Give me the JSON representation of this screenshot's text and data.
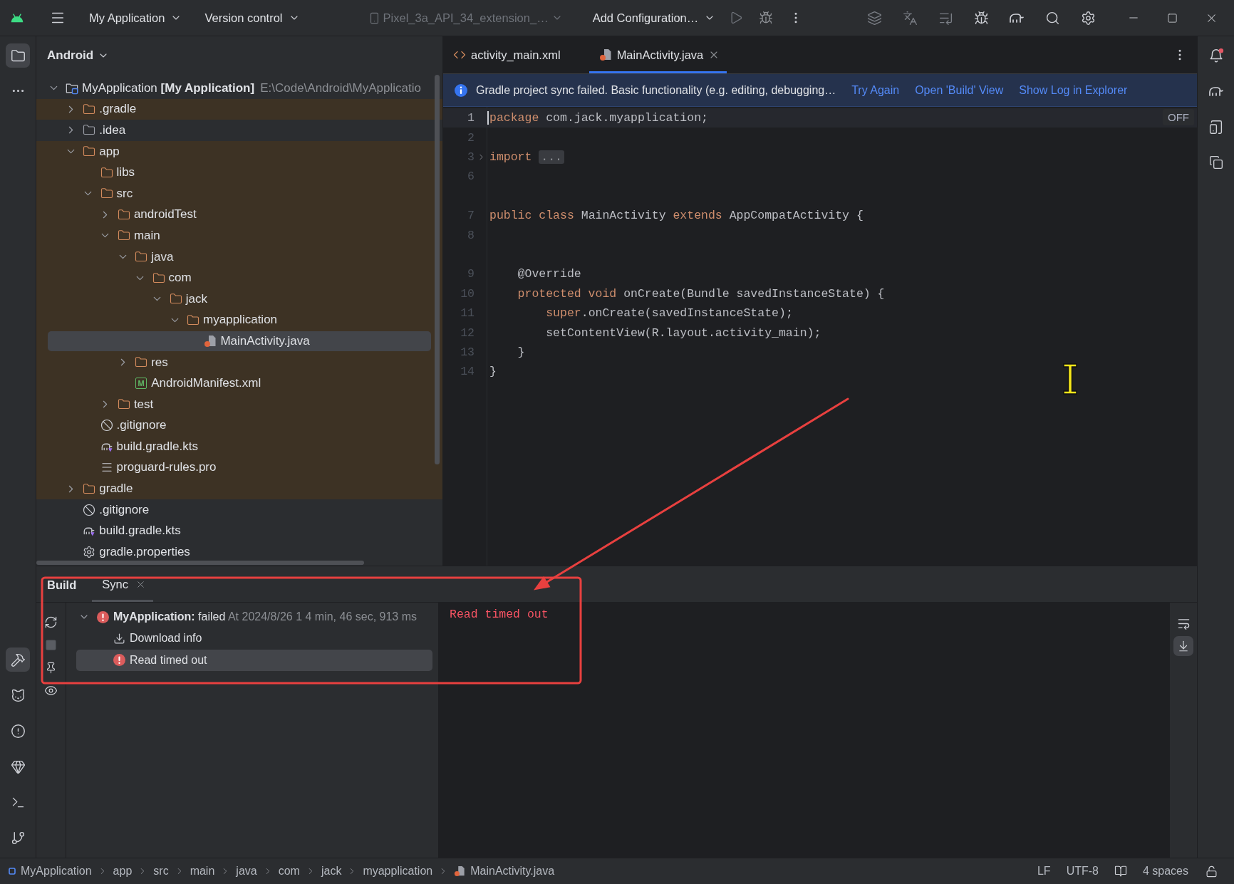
{
  "title_bar": {
    "project": "My Application",
    "vcs": "Version control",
    "device": {
      "label": "Pixel_3a_API_34_extension_…",
      "disabled": true
    },
    "configuration": "Add Configuration…"
  },
  "project_panel": {
    "view": "Android",
    "tree": [
      {
        "label": "MyApplication **[My Application]**",
        "path": "E:\\Code\\Android\\MyApplicatio",
        "kind": "module",
        "expanded": true,
        "tinted": false,
        "selected": false,
        "children": [
          {
            "label": ".gradle",
            "kind": "folder",
            "expanded": false,
            "tinted": true,
            "selected": false
          },
          {
            "label": ".idea",
            "kind": "folder",
            "expanded": false,
            "tinted": false,
            "selected": false
          },
          {
            "label": "app",
            "kind": "folder",
            "expanded": true,
            "tinted": true,
            "selected": false,
            "children": [
              {
                "label": "libs",
                "kind": "folder",
                "tinted": true,
                "selected": false
              },
              {
                "label": "src",
                "kind": "folder",
                "expanded": true,
                "tinted": true,
                "selected": false,
                "children": [
                  {
                    "label": "androidTest",
                    "kind": "folder",
                    "expanded": false,
                    "tinted": true,
                    "selected": false
                  },
                  {
                    "label": "main",
                    "kind": "folder",
                    "expanded": true,
                    "tinted": true,
                    "selected": false,
                    "children": [
                      {
                        "label": "java",
                        "kind": "folder",
                        "expanded": true,
                        "tinted": true,
                        "selected": false,
                        "children": [
                          {
                            "label": "com",
                            "kind": "folder",
                            "expanded": true,
                            "tinted": true,
                            "selected": false,
                            "children": [
                              {
                                "label": "jack",
                                "kind": "folder",
                                "expanded": true,
                                "tinted": true,
                                "selected": false,
                                "children": [
                                  {
                                    "label": "myapplication",
                                    "kind": "folder",
                                    "expanded": true,
                                    "tinted": true,
                                    "selected": false,
                                    "children": [
                                      {
                                        "label": "MainActivity.java",
                                        "kind": "java",
                                        "tinted": true,
                                        "selected": true
                                      }
                                    ]
                                  }
                                ]
                              }
                            ]
                          }
                        ]
                      },
                      {
                        "label": "res",
                        "kind": "folder",
                        "expanded": false,
                        "tinted": true,
                        "selected": false
                      },
                      {
                        "label": "AndroidManifest.xml",
                        "kind": "manifest",
                        "badge": "M",
                        "tinted": true,
                        "selected": false
                      }
                    ]
                  },
                  {
                    "label": "test",
                    "kind": "folder",
                    "expanded": false,
                    "tinted": true,
                    "selected": false
                  }
                ]
              },
              {
                "label": ".gitignore",
                "kind": "ignore",
                "tinted": true,
                "selected": false
              },
              {
                "label": "build.gradle.kts",
                "kind": "gradle",
                "tinted": true,
                "selected": false
              },
              {
                "label": "proguard-rules.pro",
                "kind": "text",
                "tinted": true,
                "selected": false
              }
            ]
          },
          {
            "label": "gradle",
            "kind": "folder",
            "expanded": false,
            "tinted": true,
            "selected": false
          },
          {
            "label": ".gitignore",
            "kind": "ignore",
            "tinted": false,
            "selected": false
          },
          {
            "label": "build.gradle.kts",
            "kind": "gradle",
            "tinted": false,
            "selected": false
          },
          {
            "label": "gradle.properties",
            "kind": "properties",
            "tinted": false,
            "selected": false
          }
        ]
      }
    ]
  },
  "editor": {
    "tabs": [
      {
        "label": "activity_main.xml",
        "kind": "xml",
        "selected": false
      },
      {
        "label": "MainActivity.java",
        "kind": "java",
        "selected": true
      }
    ],
    "banner": {
      "message": "Gradle project sync failed. Basic functionality (e.g. editing, debugging…",
      "links": [
        "Try Again",
        "Open 'Build' View",
        "Show Log in Explorer"
      ]
    },
    "inlay_toggle": "OFF",
    "lines": [
      {
        "number": "1",
        "current": true,
        "tokens": [
          {
            "kind": "keyword",
            "text": "package"
          },
          {
            "kind": "plain",
            "text": " com.jack.myapplication;"
          }
        ]
      },
      {
        "number": "2",
        "current": false
      },
      {
        "number": "3",
        "current": false,
        "folded": true,
        "tokens": [
          {
            "kind": "keyword",
            "text": "import "
          },
          {
            "kind": "fold",
            "text": "..."
          }
        ]
      },
      {
        "number": "6",
        "current": false
      },
      {
        "number": "7",
        "current": false,
        "inlay_above": true,
        "tokens": [
          {
            "kind": "keyword",
            "text": "public class"
          },
          {
            "kind": "plain",
            "text": " MainActivity "
          },
          {
            "kind": "keyword",
            "text": "extends"
          },
          {
            "kind": "plain",
            "text": " AppCompatActivity {"
          }
        ]
      },
      {
        "number": "8",
        "current": false
      },
      {
        "number": "9",
        "current": false,
        "inlay_above": true,
        "tokens": [
          {
            "kind": "plain",
            "text": "    @Override"
          }
        ]
      },
      {
        "number": "10",
        "current": false,
        "tokens": [
          {
            "kind": "keyword",
            "text": "    protected void"
          },
          {
            "kind": "plain",
            "text": " onCreate(Bundle savedInstanceState) {"
          }
        ]
      },
      {
        "number": "11",
        "current": false,
        "tokens": [
          {
            "kind": "keyword",
            "text": "        super"
          },
          {
            "kind": "plain",
            "text": ".onCreate(savedInstanceState);"
          }
        ]
      },
      {
        "number": "12",
        "current": false,
        "tokens": [
          {
            "kind": "plain",
            "text": "        setContentView(R.layout.activity_main);"
          }
        ]
      },
      {
        "number": "13",
        "current": false,
        "tokens": [
          {
            "kind": "plain",
            "text": "    }"
          }
        ]
      },
      {
        "number": "14",
        "current": false,
        "tokens": [
          {
            "kind": "plain",
            "text": "}"
          }
        ]
      }
    ]
  },
  "build_panel": {
    "title": "Build",
    "tabs": [
      {
        "label": "Sync",
        "selected": true
      }
    ],
    "tree": [
      {
        "kind": "error",
        "label": "**MyApplication:** failed",
        "details": "At 2024/8/26 1",
        "duration": "4 min, 46 sec, 913 ms",
        "expanded": true,
        "selected": false,
        "children": [
          {
            "kind": "download",
            "label": "Download info",
            "selected": false
          },
          {
            "kind": "error",
            "label": "Read timed out",
            "selected": true
          }
        ]
      }
    ],
    "console": [
      "Read timed out"
    ]
  },
  "status_bar": {
    "breadcrumbs": [
      {
        "label": "MyApplication",
        "kind": "module"
      },
      {
        "label": "app",
        "kind": "folder"
      },
      {
        "label": "src",
        "kind": "folder"
      },
      {
        "label": "main",
        "kind": "folder"
      },
      {
        "label": "java",
        "kind": "folder"
      },
      {
        "label": "com",
        "kind": "folder"
      },
      {
        "label": "jack",
        "kind": "folder"
      },
      {
        "label": "myapplication",
        "kind": "folder"
      },
      {
        "label": "MainActivity.java",
        "kind": "java"
      }
    ],
    "line_separator": "LF",
    "encoding": "UTF-8",
    "indent": "4 spaces"
  }
}
